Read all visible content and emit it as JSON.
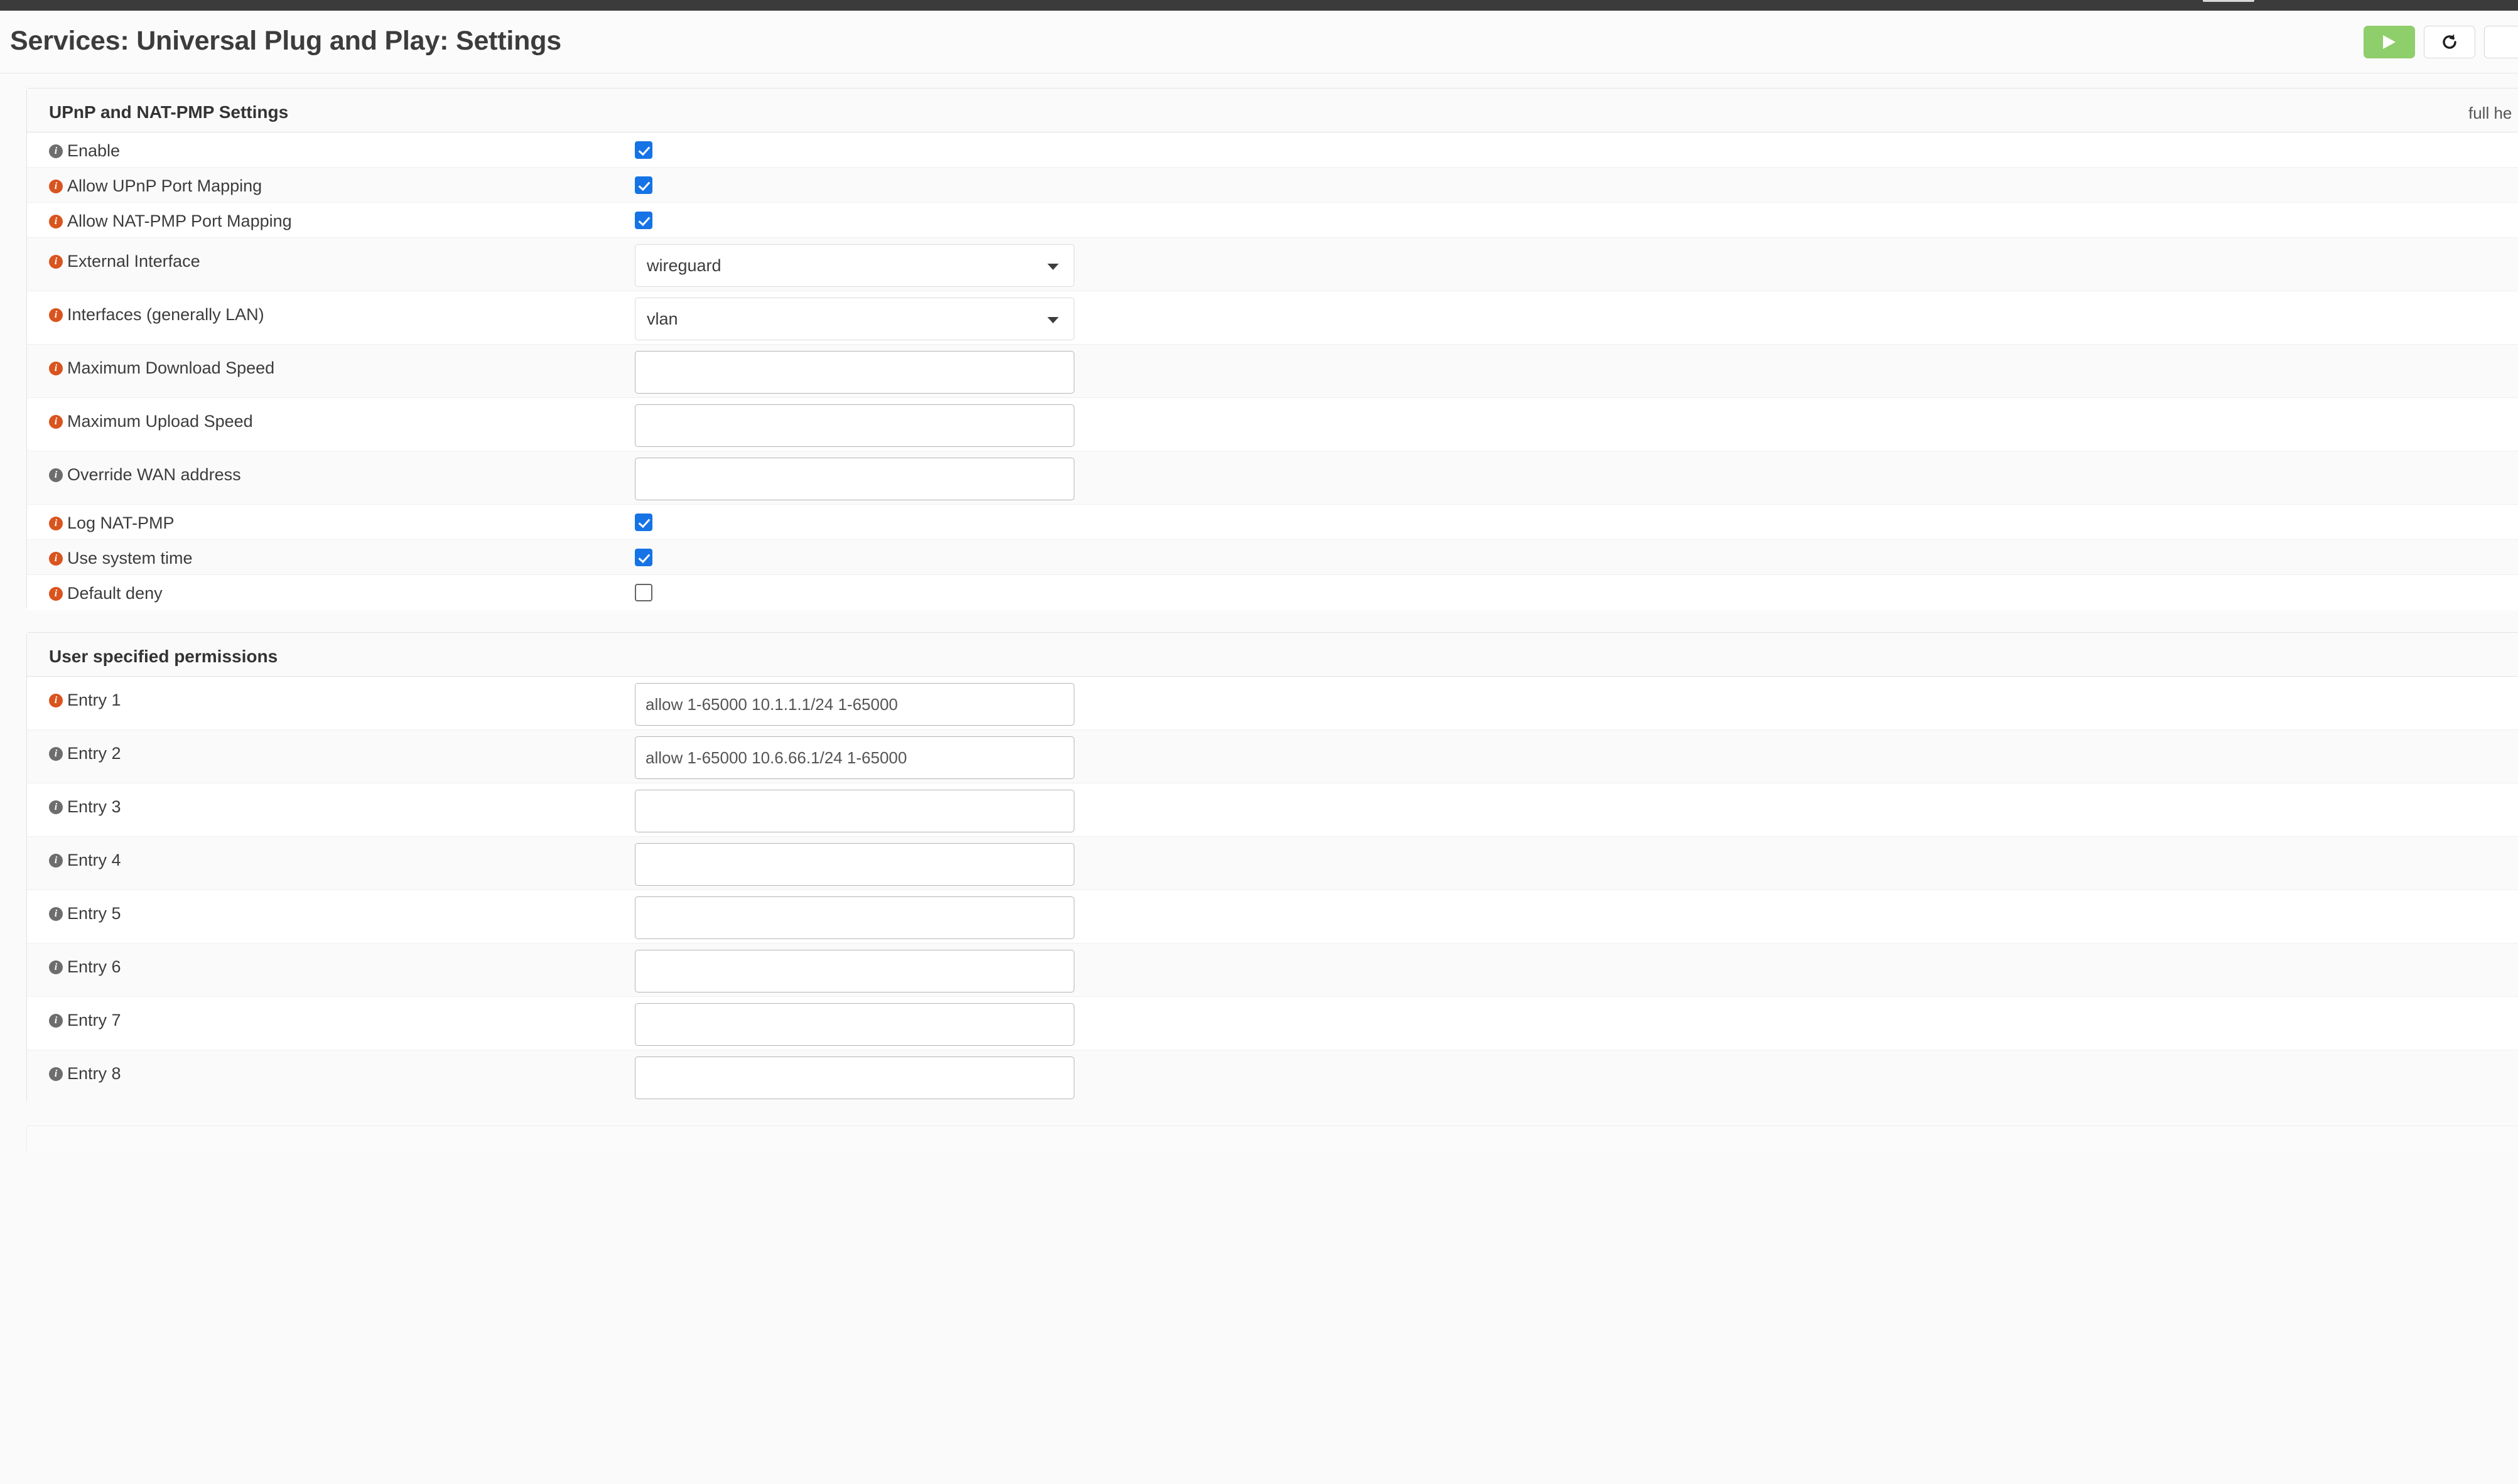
{
  "window": {
    "title": "Services: Universal Plug and Play: Settings"
  },
  "header": {
    "title": "Services: Universal Plug and Play: Settings",
    "actions": [
      {
        "name": "apply-button",
        "icon": "play-icon",
        "style": "green"
      },
      {
        "name": "reload-button",
        "icon": "refresh-icon",
        "style": "plain"
      },
      {
        "name": "overflow-button",
        "icon": "more-icon",
        "style": "plain"
      }
    ]
  },
  "panels": [
    {
      "heading": "UPnP and NAT-PMP Settings",
      "help_link": "full he",
      "rows": [
        {
          "label": "Enable",
          "icon": "grey",
          "type": "checkbox",
          "checked": true
        },
        {
          "label": "Allow UPnP Port Mapping",
          "icon": "orange",
          "type": "checkbox",
          "checked": true
        },
        {
          "label": "Allow NAT-PMP Port Mapping",
          "icon": "orange",
          "type": "checkbox",
          "checked": true
        },
        {
          "label": "External Interface",
          "icon": "orange",
          "type": "select",
          "value": "wireguard"
        },
        {
          "label": "Interfaces (generally LAN)",
          "icon": "orange",
          "type": "select",
          "value": "vlan"
        },
        {
          "label": "Maximum Download Speed",
          "icon": "orange",
          "type": "text",
          "value": ""
        },
        {
          "label": "Maximum Upload Speed",
          "icon": "orange",
          "type": "text",
          "value": ""
        },
        {
          "label": "Override WAN address",
          "icon": "grey",
          "type": "text",
          "value": ""
        },
        {
          "label": "Log NAT-PMP",
          "icon": "orange",
          "type": "checkbox",
          "checked": true
        },
        {
          "label": "Use system time",
          "icon": "orange",
          "type": "checkbox",
          "checked": true
        },
        {
          "label": "Default deny",
          "icon": "orange",
          "type": "checkbox",
          "checked": false
        }
      ]
    },
    {
      "heading": "User specified permissions",
      "help_link": "",
      "rows": [
        {
          "label": "Entry 1",
          "icon": "orange",
          "type": "text",
          "value": "allow 1-65000 10.1.1.1/24 1-65000"
        },
        {
          "label": "Entry 2",
          "icon": "grey",
          "type": "text",
          "value": "allow 1-65000 10.6.66.1/24 1-65000"
        },
        {
          "label": "Entry 3",
          "icon": "grey",
          "type": "text",
          "value": ""
        },
        {
          "label": "Entry 4",
          "icon": "grey",
          "type": "text",
          "value": ""
        },
        {
          "label": "Entry 5",
          "icon": "grey",
          "type": "text",
          "value": ""
        },
        {
          "label": "Entry 6",
          "icon": "grey",
          "type": "text",
          "value": ""
        },
        {
          "label": "Entry 7",
          "icon": "grey",
          "type": "text",
          "value": ""
        },
        {
          "label": "Entry 8",
          "icon": "grey",
          "type": "text",
          "value": ""
        }
      ]
    }
  ],
  "colors": {
    "navbar": "#3b3b3b",
    "accent_green": "#8ece6b",
    "checkbox_blue": "#1573e6",
    "info_orange": "#d9541e",
    "info_grey": "#6d6d6d"
  }
}
